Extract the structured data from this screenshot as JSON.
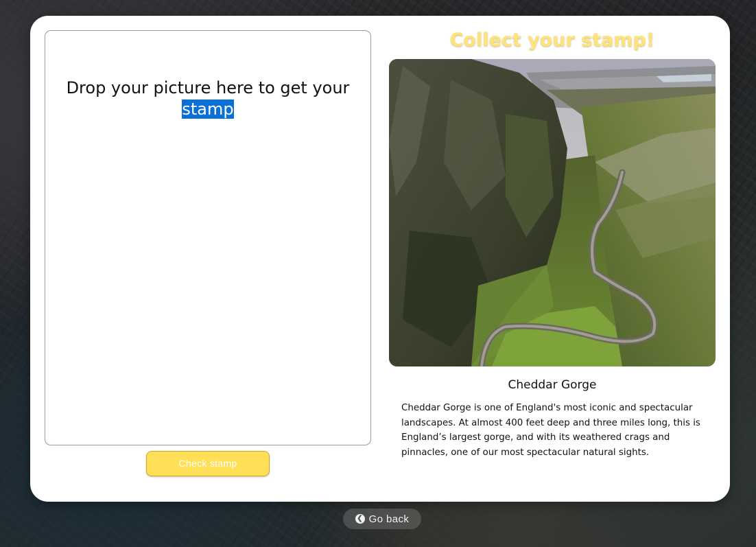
{
  "dropzone": {
    "text_before": "Drop your picture here to get your",
    "text_selected": "stamp"
  },
  "actions": {
    "check_label": "Check stamp",
    "go_back_label": "Go back",
    "go_back_icon": "chevron-left-circle-icon"
  },
  "stamp": {
    "heading": "Collect your stamp!",
    "place_name": "Cheddar Gorge",
    "description": "Cheddar Gorge is one of England's most iconic and spectacular landscapes. At almost 400 feet deep and three miles long, this is England’s largest gorge, and with its weathered crags and pinnacles, one of our most spectacular natural sights."
  },
  "colors": {
    "accent_yellow": "#fedf56",
    "heading_yellow": "#fde37a",
    "selection_blue": "#0a6fd6"
  }
}
